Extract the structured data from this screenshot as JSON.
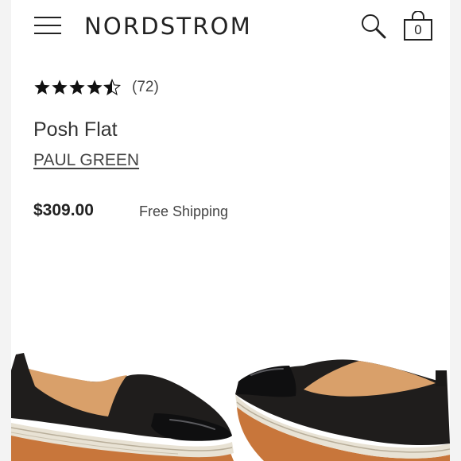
{
  "header": {
    "logo_text": "NORDSTROM",
    "bag_count": "0",
    "menu_icon": "hamburger-menu-icon",
    "search_icon": "search-icon",
    "bag_icon": "shopping-bag-icon"
  },
  "product": {
    "rating": 4.5,
    "rating_max": 5,
    "review_count": "(72)",
    "name": "Posh Flat",
    "brand": "PAUL GREEN",
    "price": "$309.00",
    "shipping": "Free Shipping"
  },
  "images": [
    {
      "name": "shoe-image-side-view",
      "colors": {
        "upper": "#1f1d1c",
        "lining": "#d9a06a",
        "toe_cap": "#0f0f10",
        "sole": "#c8763b",
        "rope": "#e8e2d4"
      }
    },
    {
      "name": "shoe-image-back-view",
      "colors": {
        "upper": "#1f1d1c",
        "lining": "#d9a06a",
        "toe_cap": "#0f0f10",
        "sole": "#c8763b",
        "rope": "#e8e2d4"
      }
    }
  ],
  "colors": {
    "text_primary": "#222222",
    "text_secondary": "#444444",
    "page_background": "#ffffff",
    "edge_background": "#f3f3f3"
  }
}
